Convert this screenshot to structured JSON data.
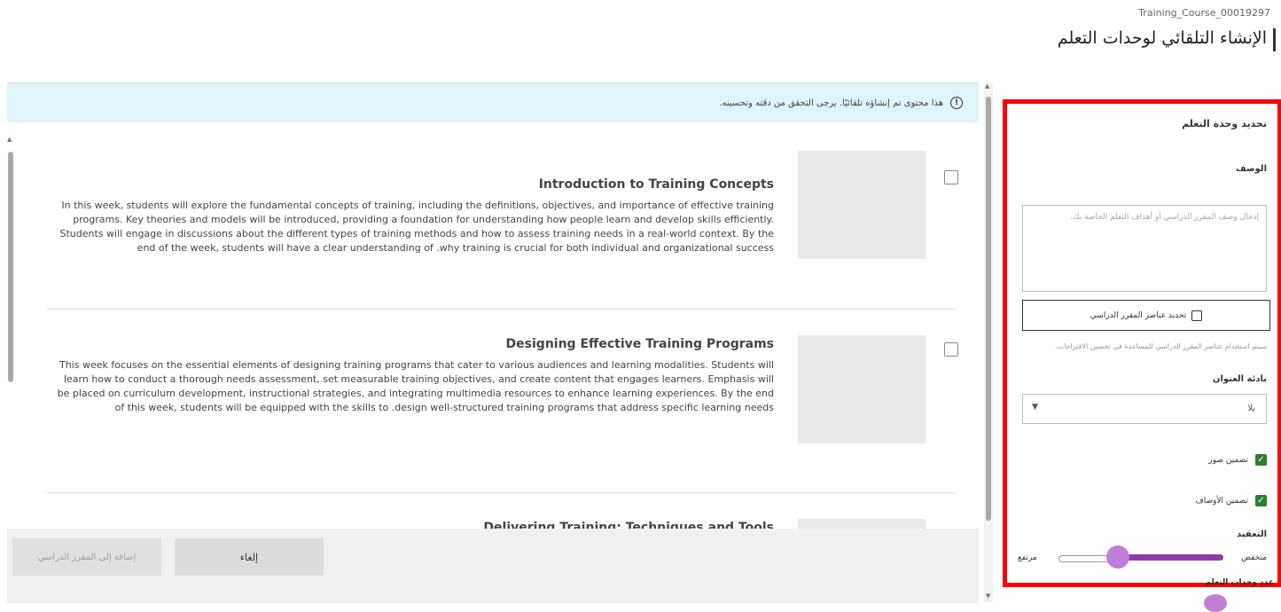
{
  "header": {
    "course_id": "Training_Course_00019297",
    "title": "الإنشاء التلقائي لوحدات التعلم"
  },
  "banner": {
    "text": "هذا محتوى تم إنشاؤه تلقائيًا. يرجى التحقق من دقته وتحسينه."
  },
  "modules": [
    {
      "title": "Introduction to Training Concepts",
      "description": "In this week, students will explore the fundamental concepts of training, including the definitions, objectives, and importance of effective training programs. Key theories and models will be introduced, providing a foundation for understanding how people learn and develop skills efficiently. Students will engage in discussions about the different types of training methods and how to assess training needs in a real-world context. By the end of the week, students will have a clear understanding of .why training is crucial for both individual and organizational success",
      "checked": false
    },
    {
      "title": "Designing Effective Training Programs",
      "description": "This week focuses on the essential elements of designing training programs that cater to various audiences and learning modalities. Students will learn how to conduct a thorough needs assessment, set measurable training objectives, and create content that engages learners. Emphasis will be placed on curriculum development, instructional strategies, and integrating multimedia resources to enhance learning experiences. By the end of this week, students will be equipped with the skills to .design well-structured training programs that address specific learning needs",
      "checked": false
    },
    {
      "title": "Delivering Training: Techniques and Tools",
      "description": "",
      "checked": false
    }
  ],
  "footer": {
    "add_label": "إضافة إلى المقرر الدراسي",
    "cancel_label": "إلغاء"
  },
  "panel": {
    "heading": "تحديد وحدة التعلم",
    "description_label": "الوصف",
    "description_placeholder": "إدخال وصف المقرر الدراسي أو أهداف التعلم الخاصة بك.",
    "select_items_button": "تحديد عناصر المقرر الدراسي",
    "select_items_hint": "سيتم استخدام عناصر المقرر الدراسي للمساعدة في تحسين الاقتراحات.",
    "title_style_label": "بادئة العنوان",
    "title_style_value": "بلا",
    "include_images_label": "تضمين صور",
    "include_images_checked": true,
    "include_descriptions_label": "تضمين الأوصاف",
    "include_descriptions_checked": true,
    "complexity_label": "التعقيد",
    "complexity_low": "منخفض",
    "complexity_high": "مرتفع",
    "count_label": "عدد وحدات التعلم"
  },
  "colors": {
    "highlight_border": "#ff0000",
    "banner_bg": "#dff4fb",
    "checkbox_green": "#2e7d32",
    "slider_purple": "#8e3aa8",
    "slider_thumb": "#c07ed9"
  }
}
